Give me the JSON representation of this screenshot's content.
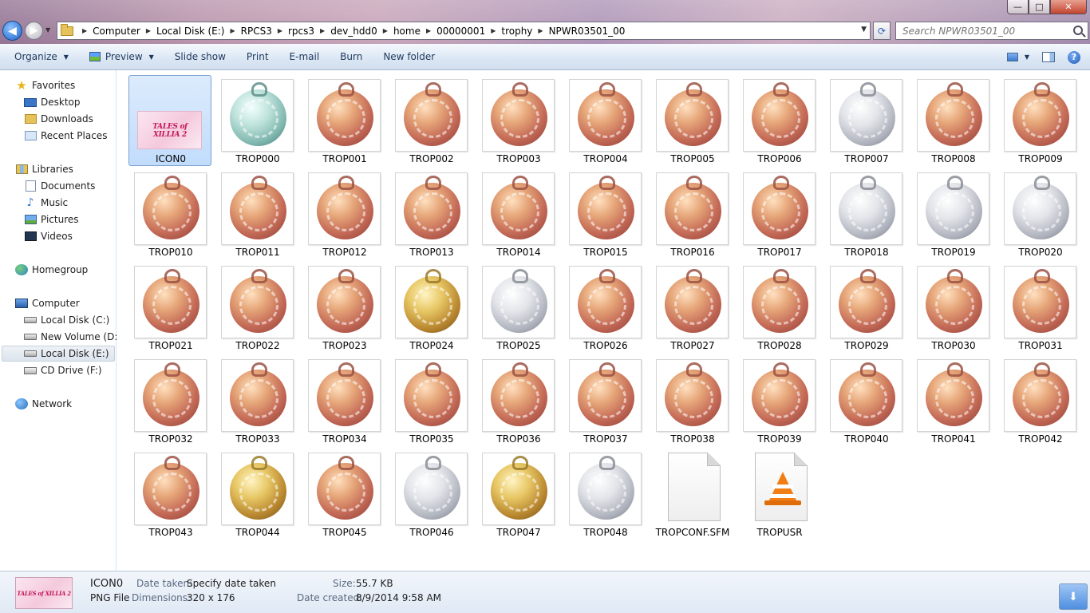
{
  "window": {
    "buttons": {
      "min": "—",
      "max": "□",
      "close": "✕"
    }
  },
  "address": {
    "crumbs": [
      "Computer",
      "Local Disk (E:)",
      "RPCS3",
      "rpcs3",
      "dev_hdd0",
      "home",
      "00000001",
      "trophy",
      "NPWR03501_00"
    ],
    "search_placeholder": "Search NPWR03501_00"
  },
  "toolbar": {
    "organize": "Organize",
    "preview": "Preview",
    "slideshow": "Slide show",
    "print": "Print",
    "email": "E-mail",
    "burn": "Burn",
    "new_folder": "New folder"
  },
  "navpane": {
    "favorites": "Favorites",
    "desktop": "Desktop",
    "downloads": "Downloads",
    "recent": "Recent Places",
    "libraries": "Libraries",
    "documents": "Documents",
    "music": "Music",
    "pictures": "Pictures",
    "videos": "Videos",
    "homegroup": "Homegroup",
    "computer": "Computer",
    "disk_c": "Local Disk (C:)",
    "disk_d": "New Volume (D:)",
    "disk_e": "Local Disk (E:)",
    "disk_f": "CD Drive (F:)",
    "network": "Network"
  },
  "logo_text": "TALES of XILLIA 2",
  "files": [
    {
      "name": "ICON0",
      "kind": "icon0"
    },
    {
      "name": "TROP000",
      "kind": "platinum"
    },
    {
      "name": "TROP001",
      "kind": "bronze"
    },
    {
      "name": "TROP002",
      "kind": "bronze"
    },
    {
      "name": "TROP003",
      "kind": "bronze"
    },
    {
      "name": "TROP004",
      "kind": "bronze"
    },
    {
      "name": "TROP005",
      "kind": "bronze"
    },
    {
      "name": "TROP006",
      "kind": "bronze"
    },
    {
      "name": "TROP007",
      "kind": "silver"
    },
    {
      "name": "TROP008",
      "kind": "bronze"
    },
    {
      "name": "TROP009",
      "kind": "bronze"
    },
    {
      "name": "TROP010",
      "kind": "bronze"
    },
    {
      "name": "TROP011",
      "kind": "bronze"
    },
    {
      "name": "TROP012",
      "kind": "bronze"
    },
    {
      "name": "TROP013",
      "kind": "bronze"
    },
    {
      "name": "TROP014",
      "kind": "bronze"
    },
    {
      "name": "TROP015",
      "kind": "bronze"
    },
    {
      "name": "TROP016",
      "kind": "bronze"
    },
    {
      "name": "TROP017",
      "kind": "bronze"
    },
    {
      "name": "TROP018",
      "kind": "silver"
    },
    {
      "name": "TROP019",
      "kind": "silver"
    },
    {
      "name": "TROP020",
      "kind": "silver"
    },
    {
      "name": "TROP021",
      "kind": "bronze"
    },
    {
      "name": "TROP022",
      "kind": "bronze"
    },
    {
      "name": "TROP023",
      "kind": "bronze"
    },
    {
      "name": "TROP024",
      "kind": "gold"
    },
    {
      "name": "TROP025",
      "kind": "silver"
    },
    {
      "name": "TROP026",
      "kind": "bronze"
    },
    {
      "name": "TROP027",
      "kind": "bronze"
    },
    {
      "name": "TROP028",
      "kind": "bronze"
    },
    {
      "name": "TROP029",
      "kind": "bronze"
    },
    {
      "name": "TROP030",
      "kind": "bronze"
    },
    {
      "name": "TROP031",
      "kind": "bronze"
    },
    {
      "name": "TROP032",
      "kind": "bronze"
    },
    {
      "name": "TROP033",
      "kind": "bronze"
    },
    {
      "name": "TROP034",
      "kind": "bronze"
    },
    {
      "name": "TROP035",
      "kind": "bronze"
    },
    {
      "name": "TROP036",
      "kind": "bronze"
    },
    {
      "name": "TROP037",
      "kind": "bronze"
    },
    {
      "name": "TROP038",
      "kind": "bronze"
    },
    {
      "name": "TROP039",
      "kind": "bronze"
    },
    {
      "name": "TROP040",
      "kind": "bronze"
    },
    {
      "name": "TROP041",
      "kind": "bronze"
    },
    {
      "name": "TROP042",
      "kind": "bronze"
    },
    {
      "name": "TROP043",
      "kind": "bronze"
    },
    {
      "name": "TROP044",
      "kind": "gold"
    },
    {
      "name": "TROP045",
      "kind": "bronze"
    },
    {
      "name": "TROP046",
      "kind": "silver"
    },
    {
      "name": "TROP047",
      "kind": "gold"
    },
    {
      "name": "TROP048",
      "kind": "silver"
    },
    {
      "name": "TROPCONF.SFM",
      "kind": "document"
    },
    {
      "name": "TROPUSR",
      "kind": "vlc"
    }
  ],
  "details": {
    "name": "ICON0",
    "type": "PNG File",
    "date_taken_label": "Date taken:",
    "date_taken": "Specify date taken",
    "dimensions_label": "Dimensions:",
    "dimensions": "320 x 176",
    "size_label": "Size:",
    "size": "55.7 KB",
    "date_created_label": "Date created:",
    "date_created": "8/9/2014 9:58 AM"
  }
}
